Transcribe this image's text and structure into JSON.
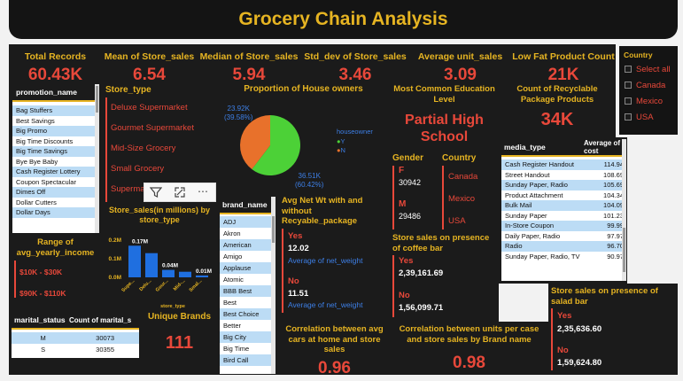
{
  "title": "Grocery Chain Analysis",
  "kpis": [
    {
      "label": "Total Records",
      "value": "60.43K"
    },
    {
      "label": "Mean of Store_sales",
      "value": "6.54"
    },
    {
      "label": "Median of Store_sales",
      "value": "5.94"
    },
    {
      "label": "Std_dev of Store_sales",
      "value": "3.46"
    },
    {
      "label": "Average unit_sales",
      "value": "3.09"
    },
    {
      "label": "Low Fat Product Count",
      "value": "21K"
    }
  ],
  "country_slicer": {
    "title": "Country",
    "items": [
      "Select all",
      "Canada",
      "Mexico",
      "USA"
    ]
  },
  "promotion": {
    "header": "promotion_name",
    "items": [
      "Bag Stuffers",
      "Best Savings",
      "Big Promo",
      "Big Time Discounts",
      "Big Time Savings",
      "Bye Bye Baby",
      "Cash Register Lottery",
      "Coupon Spectacular",
      "Dimes Off",
      "Dollar Cutters",
      "Dollar Days"
    ]
  },
  "store_type": {
    "title": "Store_type",
    "items": [
      "Deluxe Supermarket",
      "Gourmet Supermarket",
      "Mid-Size Grocery",
      "Small Grocery",
      "Supermarket"
    ]
  },
  "house_owners": {
    "title": "Proportion of House owners",
    "legend_title": "houseowner",
    "legend": [
      {
        "label": "Y",
        "color": "#4cd137"
      },
      {
        "label": "N",
        "color": "#e8712b"
      }
    ],
    "label_n": "23.92K",
    "label_n_pct": "(39.58%)",
    "label_y": "36.51K",
    "label_y_pct": "(60.42%)"
  },
  "education": {
    "title": "Most Common Education Level",
    "value": "Partial High School"
  },
  "recyclable": {
    "title": "Count of Recyclable Package Products",
    "value": "34K"
  },
  "gender": {
    "title": "Gender",
    "rows": [
      {
        "k": "F",
        "v": "30942"
      },
      {
        "k": "M",
        "v": "29486"
      }
    ]
  },
  "country_list": {
    "title": "Country",
    "items": [
      "Canada",
      "Mexico",
      "USA"
    ]
  },
  "media": {
    "headers": [
      "media_type",
      "Average of cost"
    ],
    "rows": [
      [
        "Cash Register Handout",
        "114.94"
      ],
      [
        "Street Handout",
        "108.69"
      ],
      [
        "Sunday Paper, Radio",
        "105.69"
      ],
      [
        "Product Attachment",
        "104.34"
      ],
      [
        "Bulk Mail",
        "104.09"
      ],
      [
        "Sunday Paper",
        "101.23"
      ],
      [
        "In-Store Coupon",
        "99.99"
      ],
      [
        "Daily Paper, Radio",
        "97.97"
      ],
      [
        "Radio",
        "96.70"
      ],
      [
        "Sunday Paper, Radio, TV",
        "90.97"
      ]
    ]
  },
  "chart_data": {
    "type": "bar",
    "title": "Store_sales(in millions) by store_type",
    "xlabel": "store_type",
    "ylabel": "",
    "categories": [
      "Supe...",
      "Delu...",
      "Gour...",
      "Mid-...",
      "Smal..."
    ],
    "values": [
      0.17,
      0.13,
      0.04,
      0.03,
      0.01
    ],
    "data_labels": [
      "0.17M",
      "",
      "0.04M",
      "",
      "0.01M"
    ],
    "yticks": [
      "0.2M",
      "0.1M",
      "0.0M"
    ],
    "ylim": [
      0,
      0.2
    ],
    "color": "#1f6fe0"
  },
  "brand": {
    "header": "brand_name",
    "items": [
      "ADJ",
      "Akron",
      "American",
      "Amigo",
      "Applause",
      "Atomic",
      "BBB Best",
      "Best",
      "Best Choice",
      "Better",
      "Big City",
      "Big Time",
      "Bird Call"
    ]
  },
  "net_wt": {
    "title": "Avg Net Wt with and without Recyable_package",
    "yes_label": "Yes",
    "yes_value": "12.02",
    "no_label": "No",
    "no_value": "11.51",
    "measure": "Average of net_weight"
  },
  "coffee": {
    "title": "Store sales on presence of coffee bar",
    "yes_label": "Yes",
    "yes_value": "2,39,161.69",
    "no_label": "No",
    "no_value": "1,56,099.71"
  },
  "salad": {
    "title": "Store sales on presence of salad bar",
    "yes_label": "Yes",
    "yes_value": "2,35,636.60",
    "no_label": "No",
    "no_value": "1,59,624.80"
  },
  "income": {
    "title": "Range of avg_yearly_income",
    "items": [
      "$10K - $30K",
      "$90K - $110K"
    ]
  },
  "marital": {
    "headers": [
      "marital_status",
      "Count of marital_s"
    ],
    "rows": [
      [
        "M",
        "30073"
      ],
      [
        "S",
        "30355"
      ]
    ]
  },
  "unique_brands": {
    "title": "Unique Brands",
    "value": "111"
  },
  "corr_cars": {
    "title": "Correlation between avg cars at home and store sales",
    "value": "0.96"
  },
  "corr_units": {
    "title": "Correlation between units per case and store sales by Brand name",
    "value": "0.98"
  }
}
